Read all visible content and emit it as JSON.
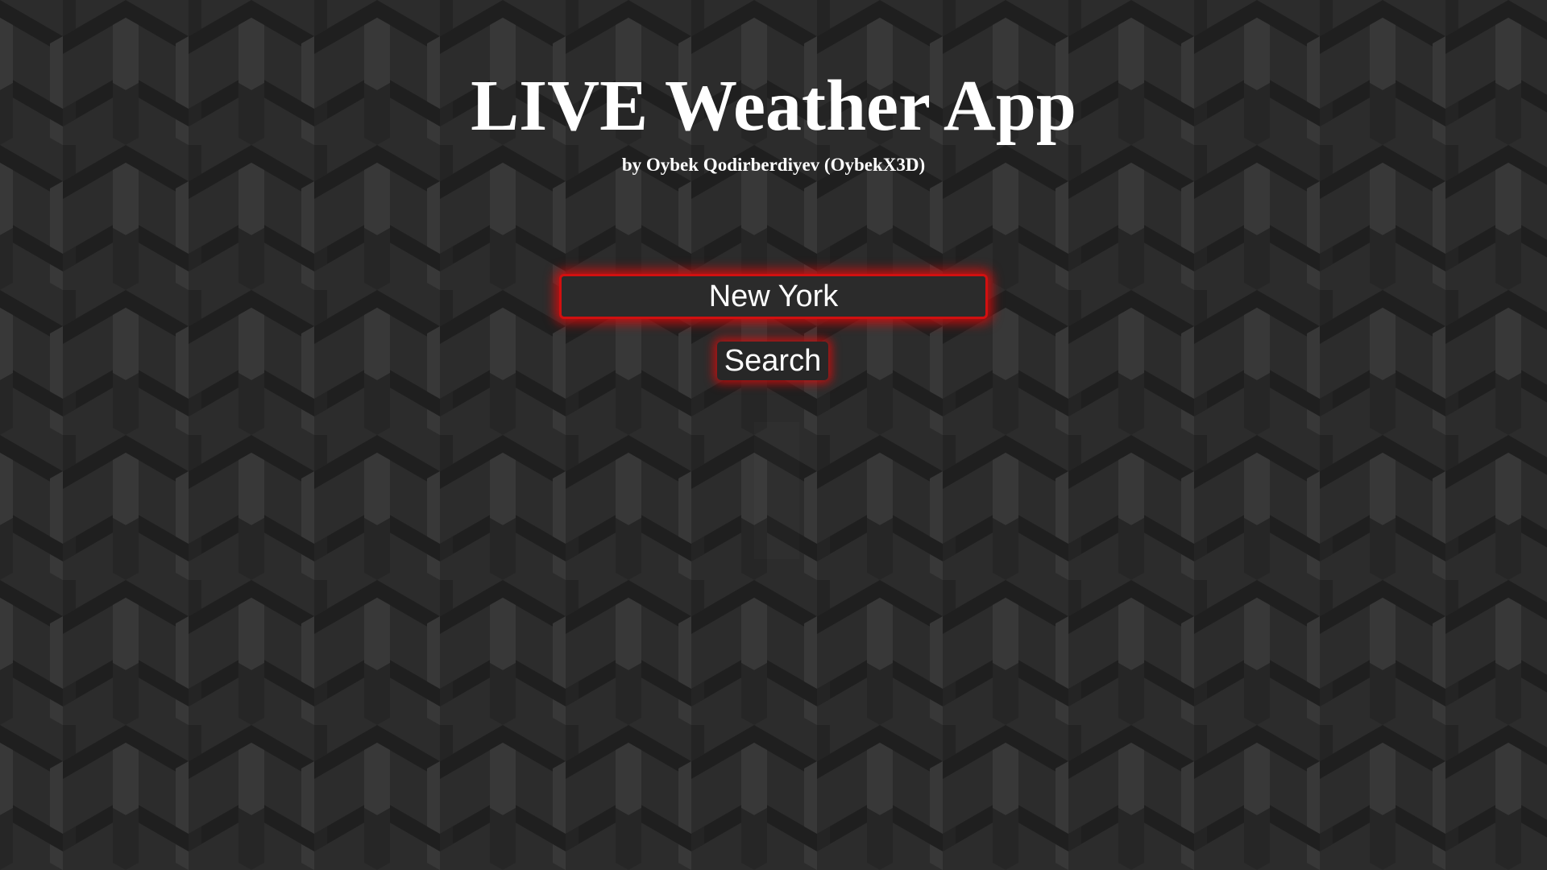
{
  "app": {
    "title": "LIVE Weather App",
    "subtitle": "by Oybek Qodirberdiyev (OybekX3D)"
  },
  "search": {
    "value": "New York",
    "button_label": "Search"
  },
  "colors": {
    "background_dark": "#1e1e1e",
    "background_mid": "#2c2c2c",
    "background_light": "#3c3c3c",
    "accent_glow": "#e00a0a",
    "text": "#ffffff"
  },
  "background": {
    "pattern": "isometric-3d-y-blocks"
  }
}
